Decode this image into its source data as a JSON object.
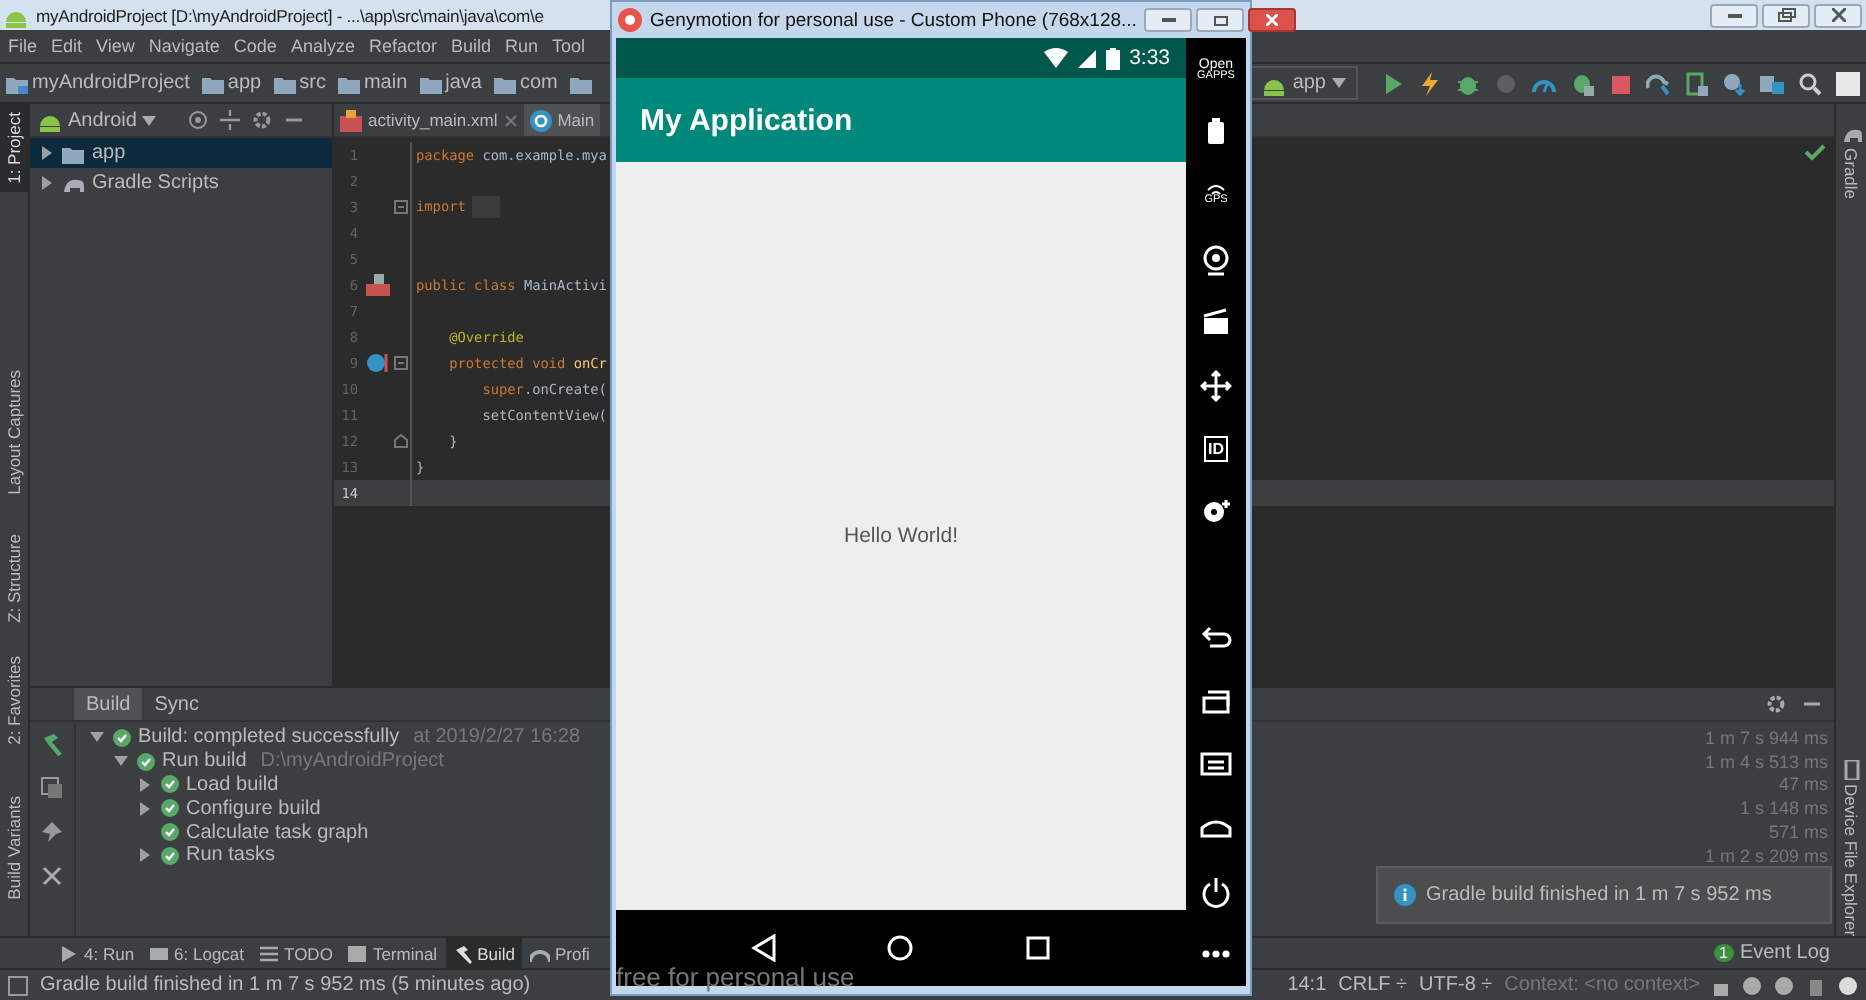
{
  "window": {
    "title": "myAndroidProject [D:\\myAndroidProject] - ...\\app\\src\\main\\java\\com\\e"
  },
  "menu": [
    "File",
    "Edit",
    "View",
    "Navigate",
    "Code",
    "Analyze",
    "Refactor",
    "Build",
    "Run",
    "Tool"
  ],
  "breadcrumbs": [
    "myAndroidProject",
    "app",
    "src",
    "main",
    "java",
    "com"
  ],
  "run_configuration": "app",
  "left_tool_tabs": [
    {
      "label": "1: Project",
      "selected": true
    },
    {
      "label": "Layout Captures",
      "selected": false
    },
    {
      "label": "Z: Structure",
      "selected": false
    },
    {
      "label": "2: Favorites",
      "selected": false
    },
    {
      "label": "Build Variants",
      "selected": false
    }
  ],
  "project_panel": {
    "view": "Android",
    "items": [
      {
        "label": "app",
        "selected": true,
        "expanded": false
      },
      {
        "label": "Gradle Scripts",
        "selected": false,
        "expanded": false
      }
    ]
  },
  "editor_tabs": [
    {
      "label": "activity_main.xml",
      "selected": false
    },
    {
      "label": "Main",
      "selected": true
    }
  ],
  "code_lines": [
    {
      "number": "1",
      "kind": "code",
      "current": false,
      "segments": [
        {
          "kind": "keyword",
          "text": "package"
        },
        {
          "kind": "plain",
          "text": " com.example.mya"
        }
      ]
    },
    {
      "number": "2",
      "kind": "blank",
      "current": false
    },
    {
      "number": "3",
      "kind": "import",
      "current": false,
      "segments": [
        {
          "kind": "keyword",
          "text": "import"
        },
        {
          "kind": "folded"
        }
      ]
    },
    {
      "number": "4",
      "kind": "blank",
      "current": false
    },
    {
      "number": "5",
      "kind": "blank",
      "current": false
    },
    {
      "number": "6",
      "kind": "class",
      "current": false,
      "segments": [
        {
          "kind": "keyword",
          "text": "public class"
        },
        {
          "kind": "plain",
          "text": " MainActivi"
        }
      ]
    },
    {
      "number": "7",
      "kind": "blank",
      "current": false
    },
    {
      "number": "8",
      "kind": "code",
      "current": false,
      "segments": [
        {
          "kind": "annotation",
          "text": "    @Override"
        }
      ]
    },
    {
      "number": "9",
      "kind": "method",
      "current": false,
      "segments": [
        {
          "kind": "keyword",
          "text": "    protected void"
        },
        {
          "kind": "method",
          "text": " onCr"
        }
      ]
    },
    {
      "number": "10",
      "kind": "code",
      "current": false,
      "segments": [
        {
          "kind": "keyword",
          "text": "        super"
        },
        {
          "kind": "plain",
          "text": ".onCreate("
        }
      ]
    },
    {
      "number": "11",
      "kind": "code",
      "current": false,
      "segments": [
        {
          "kind": "plain",
          "text": "        setContentView("
        }
      ]
    },
    {
      "number": "12",
      "kind": "block-end",
      "current": false,
      "segments": [
        {
          "kind": "plain",
          "text": "    }"
        }
      ]
    },
    {
      "number": "13",
      "kind": "code",
      "current": false,
      "segments": [
        {
          "kind": "plain",
          "text": "}"
        }
      ]
    },
    {
      "number": "14",
      "kind": "blank",
      "current": true
    }
  ],
  "right_tool_tabs": [
    "Gradle",
    "Device File Explorer"
  ],
  "build_panel": {
    "tabs": [
      {
        "label": "Build",
        "selected": true
      },
      {
        "label": "Sync",
        "selected": false
      }
    ],
    "tree": [
      {
        "label": "Build: completed successfully",
        "note": "at 2019/2/27 16:28",
        "time": "1 m 7 s 944 ms",
        "expanded": true,
        "children": [
          {
            "label": "Run build",
            "note": "D:\\myAndroidProject",
            "time": "1 m 4 s 513 ms",
            "expanded": true,
            "children": [
              {
                "label": "Load build",
                "time": "47 ms",
                "expanded": false
              },
              {
                "label": "Configure build",
                "time": "1 s 148 ms",
                "expanded": false
              },
              {
                "label": "Calculate task graph",
                "time": "571 ms"
              },
              {
                "label": "Run tasks",
                "time": "1 m 2 s 209 ms",
                "expanded": false
              }
            ]
          }
        ]
      }
    ]
  },
  "bottom_tabs": [
    {
      "label": "4: Run",
      "kind": "run",
      "selected": false
    },
    {
      "label": "6: Logcat",
      "kind": "logcat",
      "selected": false
    },
    {
      "label": "TODO",
      "kind": "todo",
      "selected": false
    },
    {
      "label": "Terminal",
      "kind": "terminal",
      "selected": false
    },
    {
      "label": "Build",
      "kind": "build",
      "selected": true
    },
    {
      "label": "Profi",
      "kind": "profiler",
      "selected": false
    }
  ],
  "event_log": {
    "count": "1",
    "label": "Event Log"
  },
  "notification": "Gradle build finished in 1 m 7 s 952 ms",
  "status_bar": {
    "message": "Gradle build finished in 1 m 7 s 952 ms (5 minutes ago)",
    "position": "14:1",
    "line_separator": "CRLF ÷",
    "encoding": "UTF-8 ÷",
    "context": "Context: <no context>"
  },
  "emulator": {
    "title": "Genymotion for personal use - Custom Phone (768x128...",
    "time": "3:33",
    "app_title": "My Application",
    "content": "Hello World!",
    "overlay": "free for personal use",
    "sidebar": [
      {
        "kind": "gapps",
        "label": "Open",
        "sublabel": "GAPPS"
      },
      {
        "kind": "battery"
      },
      {
        "kind": "gps",
        "label": "GPS"
      },
      {
        "kind": "webcam"
      },
      {
        "kind": "capture"
      },
      {
        "kind": "move"
      },
      {
        "kind": "id",
        "label": "ID"
      },
      {
        "kind": "disk"
      },
      {
        "kind": "gap"
      },
      {
        "kind": "back"
      },
      {
        "kind": "recents"
      },
      {
        "kind": "menu"
      },
      {
        "kind": "home"
      },
      {
        "kind": "power"
      },
      {
        "kind": "more"
      }
    ]
  }
}
